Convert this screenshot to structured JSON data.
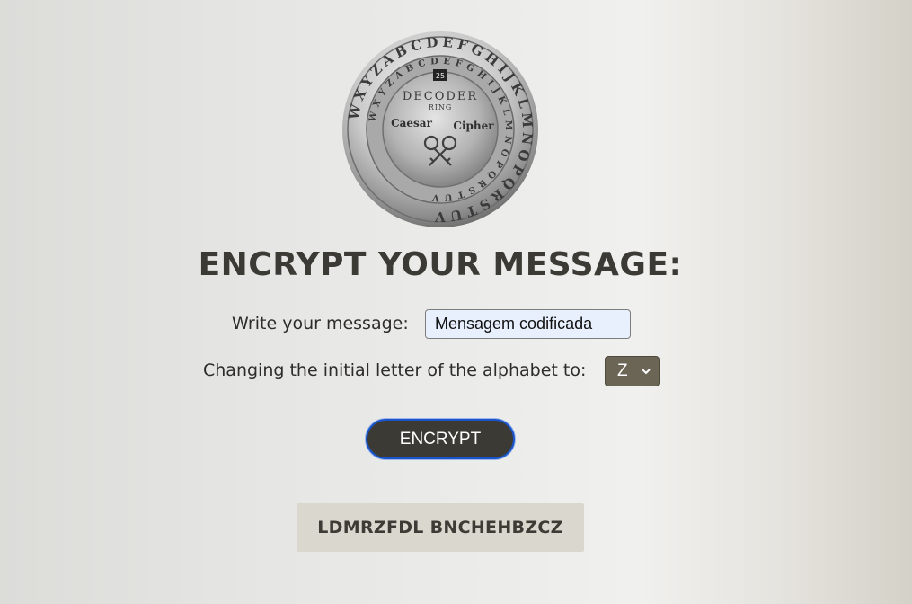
{
  "logo": {
    "outer_ring": "WXYZABCDEFGHIJKLMNOPQRSTUV",
    "inner_ring": "WXYZABCDEFGHIJKLMNOPQRSTUV",
    "center_top": "DECODER",
    "center_mid": "RING",
    "left_word": "Caesar",
    "right_word": "Cipher",
    "window_number": "25"
  },
  "title": "ENCRYPT YOUR MESSAGE:",
  "form": {
    "message_label": "Write your message:",
    "message_value": "Mensagem codificada",
    "letter_label": "Changing the initial letter of the alphabet to:",
    "letter_selected": "Z"
  },
  "encrypt_button": "ENCRYPT",
  "result": "LDMRZFDL BNCHEHBZCZ",
  "colors": {
    "primary_dark": "#3b3a35",
    "select_bg": "#6a6554",
    "result_bg": "#dad7ce",
    "focus_border": "#1b54c9"
  }
}
